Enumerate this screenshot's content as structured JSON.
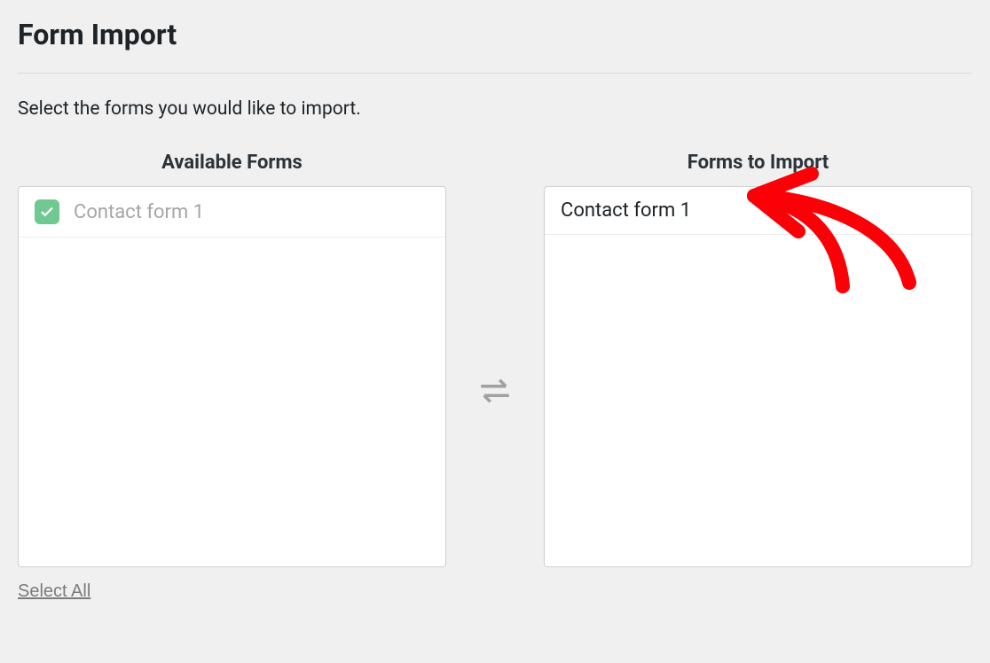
{
  "page": {
    "title": "Form Import",
    "instruction": "Select the forms you would like to import."
  },
  "columns": {
    "available": {
      "title": "Available Forms",
      "items": [
        {
          "label": "Contact form 1",
          "checked": true
        }
      ],
      "select_all_label": "Select All"
    },
    "to_import": {
      "title": "Forms to Import",
      "items": [
        {
          "label": "Contact form 1"
        }
      ]
    }
  }
}
